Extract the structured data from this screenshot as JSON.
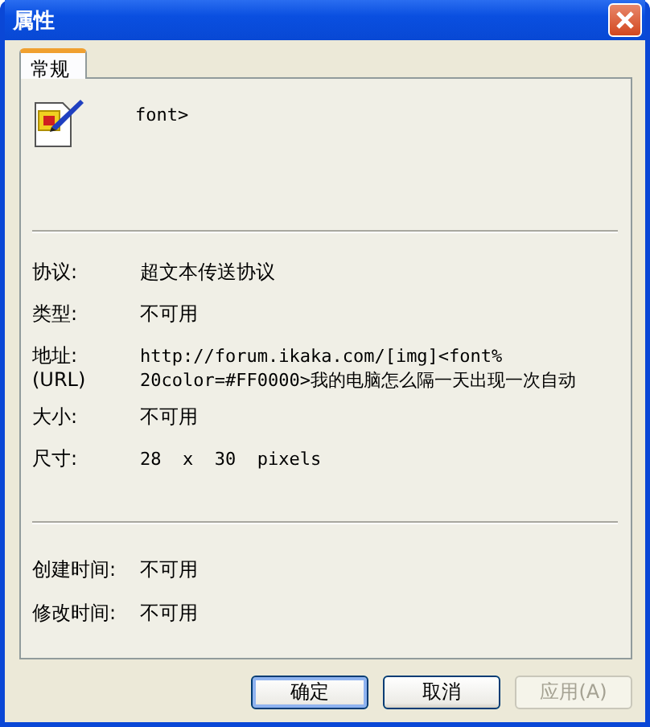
{
  "window": {
    "title": "属性"
  },
  "tabs": [
    {
      "label": "常规",
      "selected": true
    }
  ],
  "file": {
    "name": "font>"
  },
  "properties": [
    {
      "label": "协议:",
      "lines": [
        "超文本传送协议"
      ],
      "mono": false
    },
    {
      "label": "类型:",
      "lines": [
        "不可用"
      ],
      "mono": false
    },
    {
      "label": "地址:",
      "sublabel": "(URL)",
      "lines": [
        "http://forum.ikaka.com/[img]<font%",
        "20color=#FF0000>我的电脑怎么隔一天出现一次自动"
      ],
      "mono": true
    },
    {
      "label": "大小:",
      "lines": [
        "不可用"
      ],
      "mono": false
    },
    {
      "label": "尺寸:",
      "lines": [
        "28  x  30  pixels"
      ],
      "mono": true
    }
  ],
  "times": [
    {
      "label": "创建时间:",
      "value": "不可用"
    },
    {
      "label": "修改时间:",
      "value": "不可用"
    }
  ],
  "buttons": [
    {
      "label": "确定",
      "default": true,
      "disabled": false
    },
    {
      "label": "取消",
      "default": false,
      "disabled": false
    },
    {
      "label": "应用(A)",
      "default": false,
      "disabled": true
    }
  ]
}
